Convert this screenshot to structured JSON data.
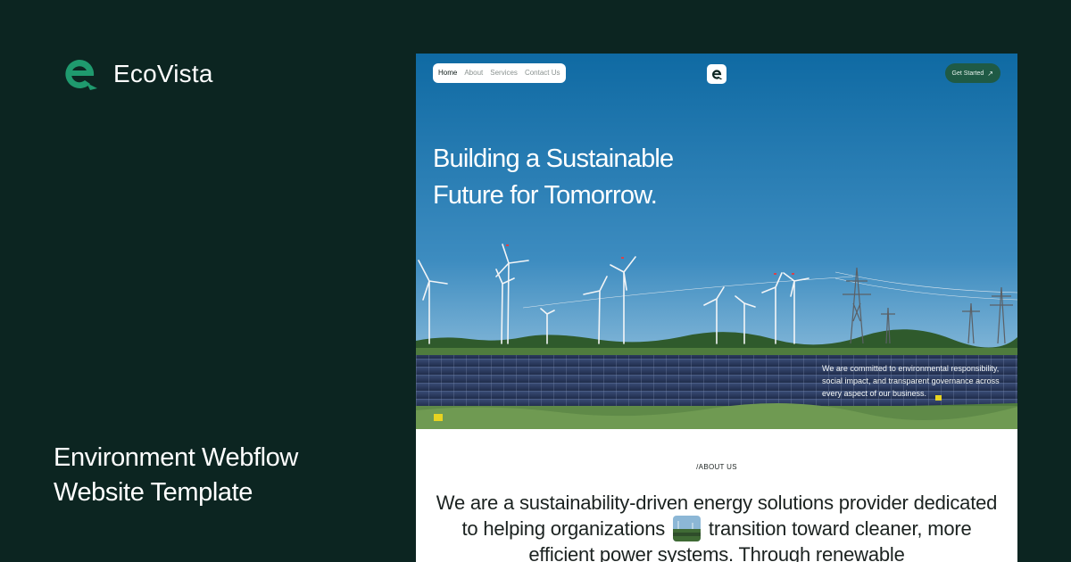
{
  "brand": {
    "name": "EcoVista",
    "logo_icon": "eco-e-logo-icon",
    "accent": "#1f9a6e"
  },
  "tagline": "Environment Webflow Website Template",
  "colors": {
    "background": "#0c2521",
    "cta_bg": "#1f5a45"
  },
  "mockup": {
    "nav": {
      "items": [
        "Home",
        "About",
        "Services",
        "Contact Us"
      ],
      "active": "Home"
    },
    "center_logo_icon": "eco-e-logo-icon",
    "cta": {
      "label": "Get Started",
      "icon": "arrow-up-right-icon"
    },
    "hero": {
      "title": "Building a Sustainable Future for Tomorrow.",
      "note": "We are committed to environmental responsibility, social impact, and transparent governance across every aspect of our business."
    },
    "about": {
      "label": "/ABOUT US",
      "text_before": "We are a sustainability-driven energy solutions provider dedicated to helping organizations",
      "text_after": "transition toward cleaner, more efficient power systems. Through renewable"
    }
  }
}
